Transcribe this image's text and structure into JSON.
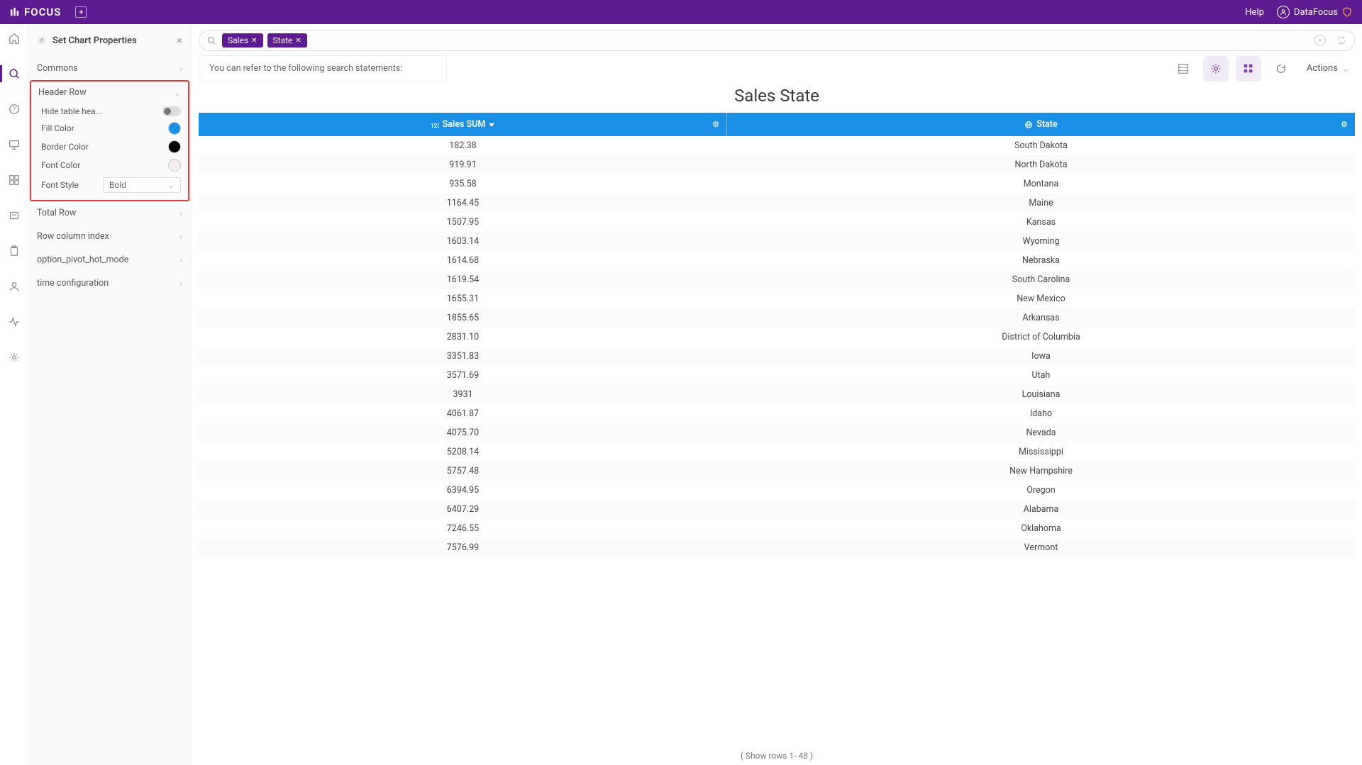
{
  "brand": {
    "name": "FOCUS",
    "color_primary": "#5c1b91",
    "color_accent": "#1a8fe6"
  },
  "topbar": {
    "help": "Help",
    "username": "DataFocus"
  },
  "panel": {
    "title": "Set Chart Properties",
    "sections": {
      "commons": "Commons",
      "header_row": "Header Row",
      "total_row": "Total Row",
      "row_column_index": "Row column index",
      "pivot_mode": "option_pivot_hot_mode",
      "time_config": "time configuration"
    },
    "header_props": {
      "hide": "Hide table hea...",
      "fill": "Fill Color",
      "border": "Border Color",
      "font_color": "Font Color",
      "font_style": "Font Style",
      "font_style_value": "Bold",
      "fill_color_value": "#1a8fe6",
      "border_color_value": "#000000",
      "font_color_value": "#f5eeee"
    }
  },
  "search": {
    "pills": [
      {
        "label": "Sales"
      },
      {
        "label": "State"
      }
    ],
    "hint": "You can refer to the following search statements:"
  },
  "toolbar": {
    "actions": "Actions"
  },
  "chart": {
    "title": "Sales State",
    "col1": "Sales SUM",
    "col2": "State",
    "footer": "( Show rows 1- 48 )",
    "rows": [
      {
        "sales": "182.38",
        "state": "South Dakota"
      },
      {
        "sales": "919.91",
        "state": "North Dakota"
      },
      {
        "sales": "935.58",
        "state": "Montana"
      },
      {
        "sales": "1164.45",
        "state": "Maine"
      },
      {
        "sales": "1507.95",
        "state": "Kansas"
      },
      {
        "sales": "1603.14",
        "state": "Wyoming"
      },
      {
        "sales": "1614.68",
        "state": "Nebraska"
      },
      {
        "sales": "1619.54",
        "state": "South Carolina"
      },
      {
        "sales": "1655.31",
        "state": "New Mexico"
      },
      {
        "sales": "1855.65",
        "state": "Arkansas"
      },
      {
        "sales": "2831.10",
        "state": "District of Columbia"
      },
      {
        "sales": "3351.83",
        "state": "Iowa"
      },
      {
        "sales": "3571.69",
        "state": "Utah"
      },
      {
        "sales": "3931",
        "state": "Louisiana"
      },
      {
        "sales": "4061.87",
        "state": "Idaho"
      },
      {
        "sales": "4075.70",
        "state": "Nevada"
      },
      {
        "sales": "5208.14",
        "state": "Mississippi"
      },
      {
        "sales": "5757.48",
        "state": "New Hampshire"
      },
      {
        "sales": "6394.95",
        "state": "Oregon"
      },
      {
        "sales": "6407.29",
        "state": "Alabama"
      },
      {
        "sales": "7246.55",
        "state": "Oklahoma"
      },
      {
        "sales": "7576.99",
        "state": "Vermont"
      }
    ]
  },
  "chart_data": {
    "type": "table",
    "title": "Sales State",
    "columns": [
      "Sales SUM",
      "State"
    ],
    "rows": [
      [
        182.38,
        "South Dakota"
      ],
      [
        919.91,
        "North Dakota"
      ],
      [
        935.58,
        "Montana"
      ],
      [
        1164.45,
        "Maine"
      ],
      [
        1507.95,
        "Kansas"
      ],
      [
        1603.14,
        "Wyoming"
      ],
      [
        1614.68,
        "Nebraska"
      ],
      [
        1619.54,
        "South Carolina"
      ],
      [
        1655.31,
        "New Mexico"
      ],
      [
        1855.65,
        "Arkansas"
      ],
      [
        2831.1,
        "District of Columbia"
      ],
      [
        3351.83,
        "Iowa"
      ],
      [
        3571.69,
        "Utah"
      ],
      [
        3931,
        "Louisiana"
      ],
      [
        4061.87,
        "Idaho"
      ],
      [
        4075.7,
        "Nevada"
      ],
      [
        5208.14,
        "Mississippi"
      ],
      [
        5757.48,
        "New Hampshire"
      ],
      [
        6394.95,
        "Oregon"
      ],
      [
        6407.29,
        "Alabama"
      ],
      [
        7246.55,
        "Oklahoma"
      ],
      [
        7576.99,
        "Vermont"
      ]
    ],
    "total_rows": 48
  }
}
